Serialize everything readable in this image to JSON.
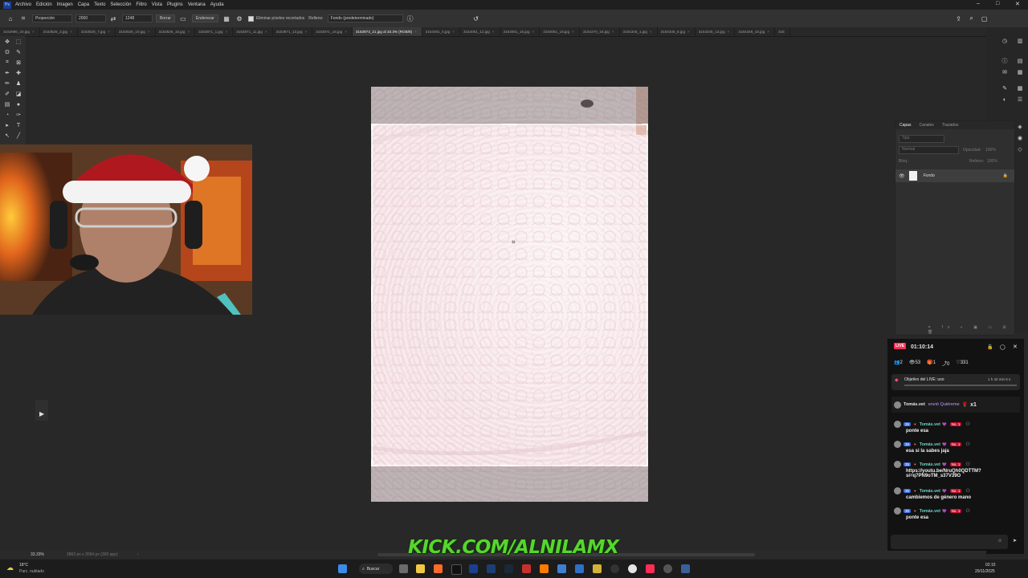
{
  "menu": {
    "app_logo": "Ps",
    "items": [
      "Archivo",
      "Edición",
      "Imagen",
      "Capa",
      "Texto",
      "Selección",
      "Filtro",
      "Vista",
      "Plugins",
      "Ventana",
      "Ayuda"
    ]
  },
  "options_bar": {
    "ratio_select": "Proporción",
    "width_value": "2000",
    "height_value": "1248",
    "clear_label": "Borrar",
    "straighten_label": "Enderezar",
    "delete_cropped_label": "Eliminar píxeles recortados",
    "fill_label": "Relleno:",
    "fill_value": "Fondo (predeterminado)"
  },
  "tabs": [
    "3152980_20.jpg",
    "3153526_3.jpg",
    "3153526_7.jpg",
    "3153526_10.jpg",
    "3153526_15.jpg",
    "3153871_1.jpg",
    "3153871_11.jpg",
    "3153871_13.jpg",
    "3153871_16.jpg",
    "3153973_21.jpg al 33.3% (RGB/8)",
    "3154061_5.jpg",
    "3154061_12.jpg",
    "3154061_16.jpg",
    "3154061_18.jpg",
    "3154270_18.jpg",
    "3154346_1.jpg",
    "3154346_8.jpg",
    "3154346_13.jpg",
    "3154346_15.jpg",
    "315"
  ],
  "active_tab_index": 9,
  "layers_panel": {
    "tabs": [
      "Capas",
      "Canales",
      "Trazados"
    ],
    "search_placeholder": "Tipo",
    "blend_mode": "Normal",
    "opacity_label": "Opacidad:",
    "opacity_value": "100%",
    "lock_label": "Bloq.:",
    "fill_label": "Relleno:",
    "fill_value": "100%",
    "layer_name": "Fondo"
  },
  "status_bar": {
    "zoom": "33.33%",
    "doc_info": "2863 px x 3094 px (300 ppp)"
  },
  "live_panel": {
    "badge": "LIVE",
    "timer": "01:10:14",
    "stats": {
      "a": "2",
      "viewers": "53",
      "gifts": "1",
      "shares": "0",
      "likes": "331"
    },
    "goal_label": "Objetivo del LIVE: uso",
    "goal_time": "1 h 42 min 5 s",
    "gift": {
      "user": "Tomás.vet",
      "action": "envió Quiéreme",
      "count": "x1"
    },
    "level": "35",
    "rank": "No. 1",
    "messages": [
      {
        "user": "Tomás.vet",
        "text": "ponte esa"
      },
      {
        "user": "Tomás.vet",
        "text": "esa si la sabes jaja"
      },
      {
        "user": "Tomás.vet",
        "text": "https://youtu.be/NruQh0QDTTM?si=q7PN9oTM_s37V39O"
      },
      {
        "user": "Tomás.vet",
        "text": "cambiemos de género mano"
      },
      {
        "user": "Tomás.vet",
        "text": "ponte esa"
      }
    ]
  },
  "watermark": "KICK.COM/ALNILAMX",
  "taskbar": {
    "temperature": "18°C",
    "weather": "Parc. nublado",
    "search_label": "Buscar",
    "time": "02:15",
    "date": "20/11/2025"
  }
}
